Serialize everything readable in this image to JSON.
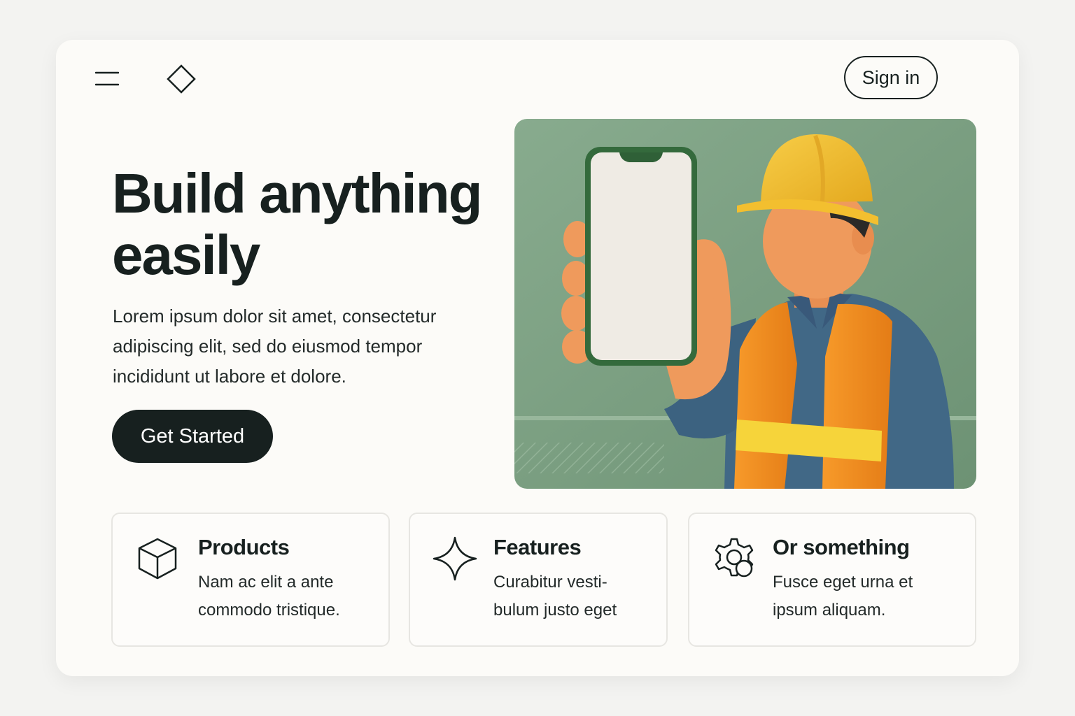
{
  "nav": {
    "menu_icon": "hamburger-menu-icon",
    "logo_icon": "diamond-logo-icon",
    "signin_label": "Sign in"
  },
  "hero": {
    "title": "Build anything easily",
    "description": "Lorem ipsum dolor sit amet, consectetur adipiscing elit, sed do eiusmod tempor incididunt ut labore et dolore.",
    "cta_label": "Get Started",
    "image": "construction-worker-holding-phone-illustration"
  },
  "features": [
    {
      "icon": "cube-icon",
      "title": "Products",
      "description": "Nam ac elit a ante commodo tristique."
    },
    {
      "icon": "sparkle-icon",
      "title": "Features",
      "description": "Curabitur vesti- bulum justo eget"
    },
    {
      "icon": "settings-icon",
      "title": "Or something",
      "description": "Fusce eget urna et ipsum aliquam."
    }
  ],
  "colors": {
    "page_background": "#f3f3f1",
    "card_background": "#fcfbf8",
    "ink": "#17201f",
    "image_background": "#7a9f80",
    "helmet": "#f2bd2e",
    "vest": "#f28c22",
    "shirt": "#416886",
    "skin": "#ef9a5c"
  }
}
